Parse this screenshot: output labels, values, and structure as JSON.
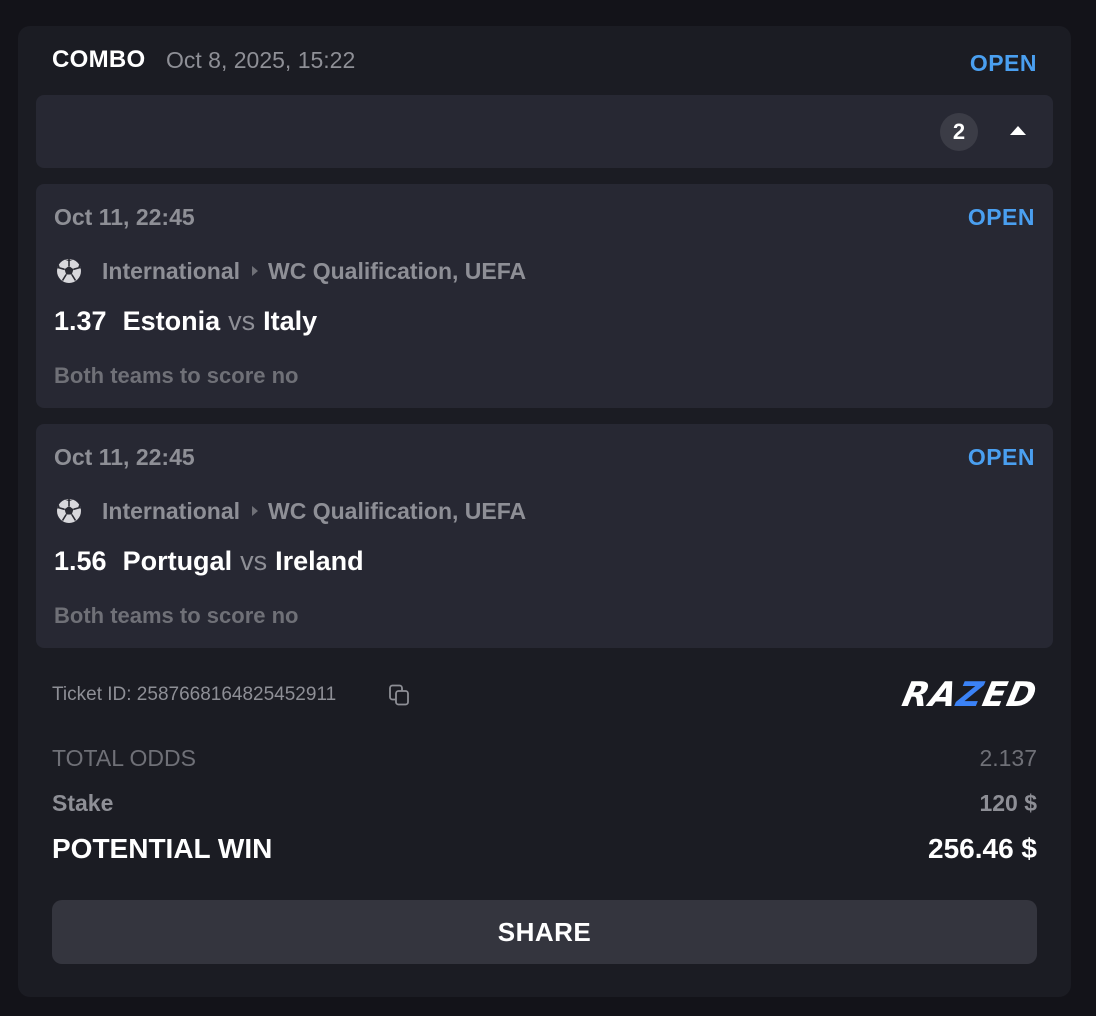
{
  "header": {
    "type_label": "COMBO",
    "datetime": "Oct 8, 2025, 15:22",
    "status": "OPEN"
  },
  "selections_bar": {
    "count": "2",
    "toggle_icon": "caret-up-icon"
  },
  "bets": [
    {
      "datetime": "Oct 11, 22:45",
      "status": "OPEN",
      "sport_icon": "soccer-ball-icon",
      "category": "International",
      "tournament": "WC Qualification, UEFA",
      "odds": "1.37",
      "home": "Estonia",
      "vs": "vs",
      "away": "Italy",
      "selection": "Both teams to score no"
    },
    {
      "datetime": "Oct 11, 22:45",
      "status": "OPEN",
      "sport_icon": "soccer-ball-icon",
      "category": "International",
      "tournament": "WC Qualification, UEFA",
      "odds": "1.56",
      "home": "Portugal",
      "vs": "vs",
      "away": "Ireland",
      "selection": "Both teams to score no"
    }
  ],
  "ticket": {
    "id_text": "Ticket ID: 2587668164825452911",
    "copy_icon": "copy-icon"
  },
  "brand": {
    "logo_before": "RA",
    "logo_accent": "Z",
    "logo_after": "ED",
    "accent_color": "#3b82f6"
  },
  "summary": {
    "total_odds_label": "TOTAL ODDS",
    "total_odds_value": "2.137",
    "stake_label": "Stake",
    "stake_value": "120 $",
    "potential_win_label": "POTENTIAL WIN",
    "potential_win_value": "256.46 $"
  },
  "actions": {
    "share_label": "SHARE"
  },
  "colors": {
    "background": "#131319",
    "card": "#1b1c23",
    "panel": "#272833",
    "open_status": "#4a9ff0",
    "muted_text": "#8e8f96"
  }
}
